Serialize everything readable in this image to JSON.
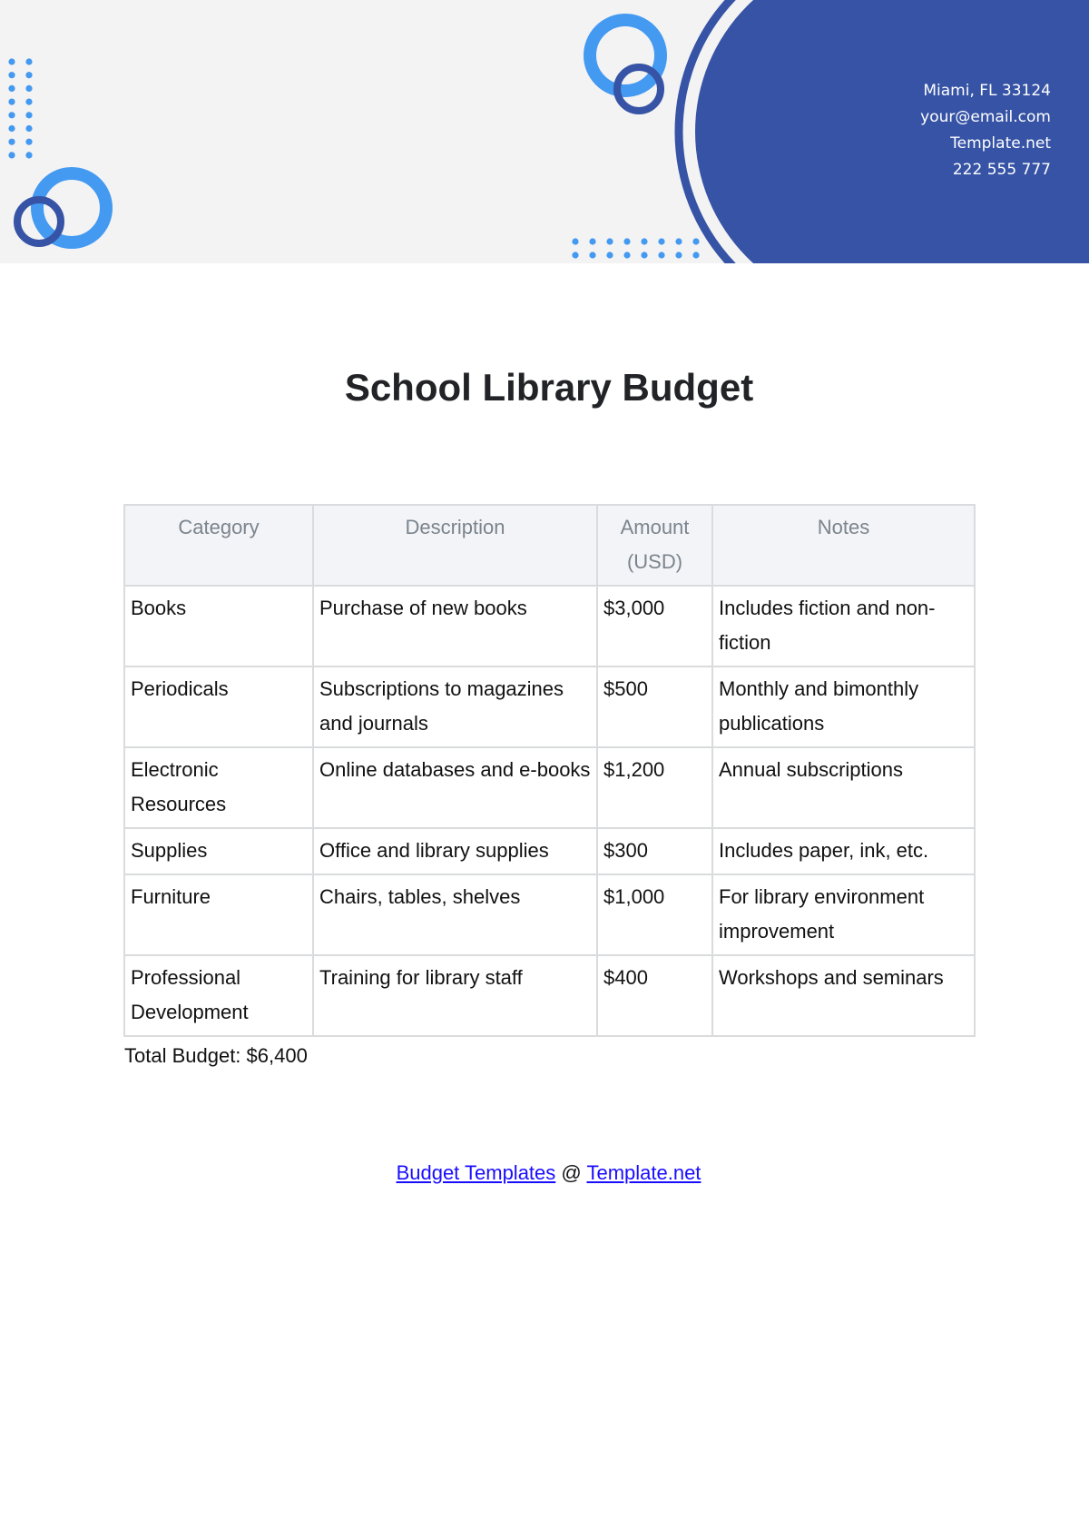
{
  "header": {
    "colors": {
      "band_background": "#f3f3f4",
      "primary_blue": "#3653a5",
      "accent_blue": "#4499f0"
    },
    "contact": {
      "address": "Miami, FL 33124",
      "email": "your@email.com",
      "website": "Template.net",
      "phone": "222 555 777"
    }
  },
  "document": {
    "title": "School Library Budget"
  },
  "table": {
    "headers": [
      "Category",
      "Description",
      "Amount (USD)",
      "Notes"
    ],
    "rows": [
      {
        "category": "Books",
        "description": "Purchase of new books",
        "amount": "$3,000",
        "notes": "Includes fiction and non-fiction"
      },
      {
        "category": "Periodicals",
        "description": "Subscriptions to magazines and journals",
        "amount": "$500",
        "notes": "Monthly and bimonthly publications"
      },
      {
        "category": "Electronic Resources",
        "description": "Online databases and e-books",
        "amount": "$1,200",
        "notes": "Annual subscriptions"
      },
      {
        "category": "Supplies",
        "description": "Office and library supplies",
        "amount": "$300",
        "notes": "Includes paper, ink, etc."
      },
      {
        "category": "Furniture",
        "description": "Chairs, tables, shelves",
        "amount": "$1,000",
        "notes": "For library environment improvement"
      },
      {
        "category": "Professional Development",
        "description": "Training for library staff",
        "amount": "$400",
        "notes": "Workshops and seminars"
      }
    ]
  },
  "total": {
    "label": "Total Budget: $6,400"
  },
  "footer": {
    "link1": "Budget Templates",
    "separator": " @ ",
    "link2": "Template.net"
  }
}
